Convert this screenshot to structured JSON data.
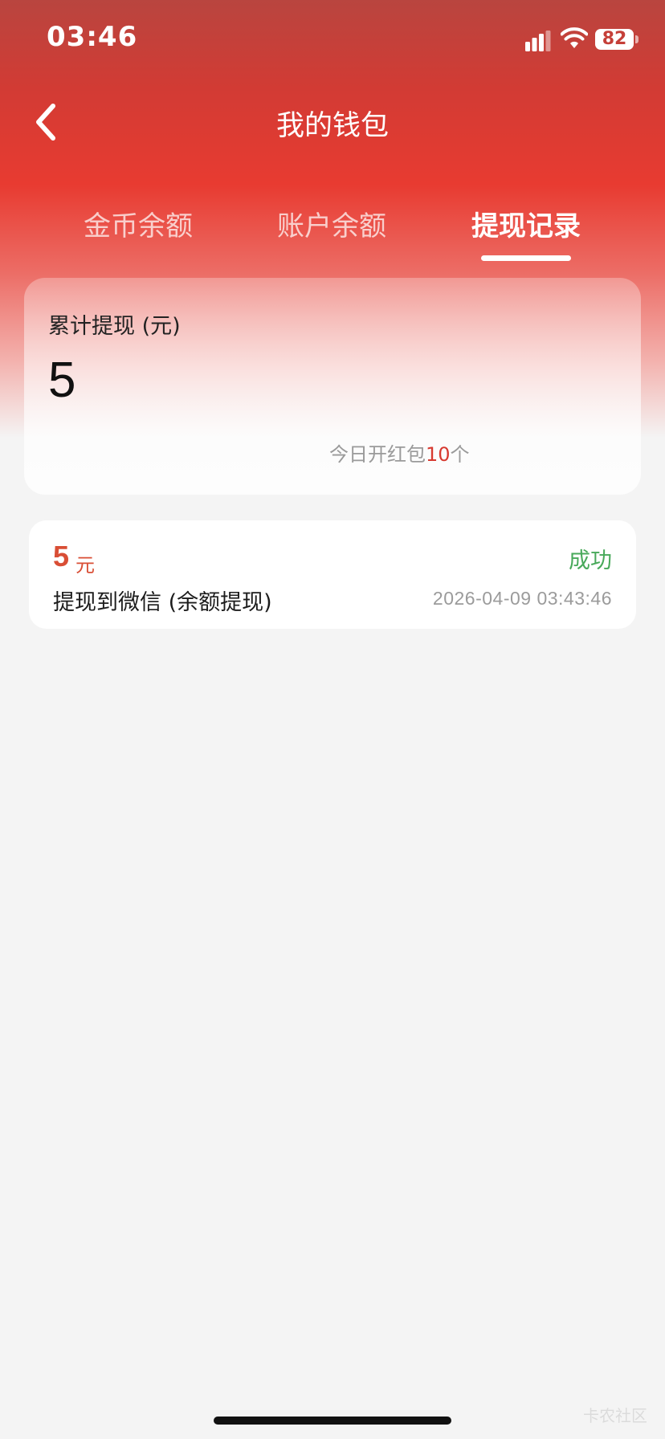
{
  "status_bar": {
    "time": "03:46",
    "battery": "82",
    "icons": [
      "signal-icon",
      "wifi-icon",
      "battery-icon"
    ]
  },
  "header": {
    "title": "我的钱包",
    "back_icon": "chevron-left-icon"
  },
  "tabs": [
    {
      "label": "金币余额",
      "active": false
    },
    {
      "label": "账户余额",
      "active": false
    },
    {
      "label": "提现记录",
      "active": true
    }
  ],
  "summary": {
    "label": "累计提现 (元)",
    "amount": "5",
    "today_prefix": "今日开红包",
    "today_count": "10",
    "today_suffix": "个"
  },
  "records": [
    {
      "amount": "5",
      "unit": "元",
      "status": "成功",
      "description": "提现到微信 (余额提现)",
      "time": "2026-04-09 03:43:46"
    }
  ],
  "watermark": "卡农社区",
  "colors": {
    "header_red": "#e83b31",
    "amount_red": "#d94e35",
    "success_green": "#48a95a"
  }
}
